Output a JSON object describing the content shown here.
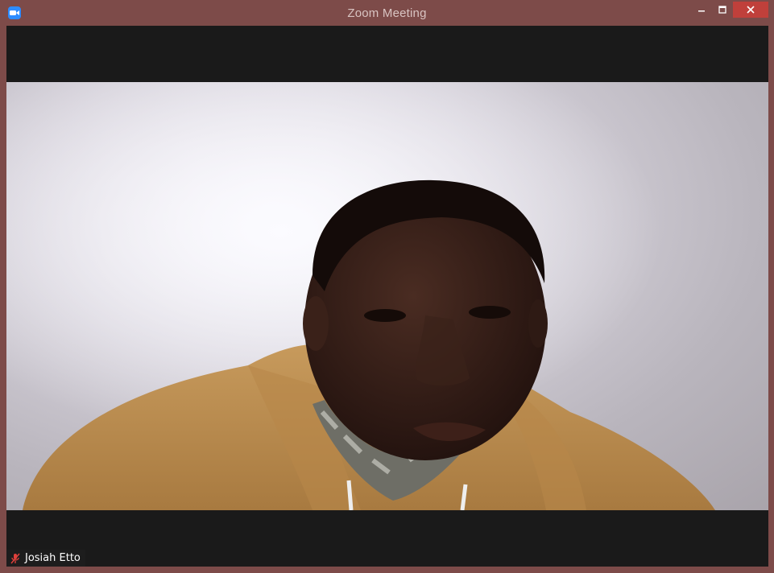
{
  "window": {
    "title": "Zoom Meeting",
    "accent": "#2d8cff",
    "titlebar_color": "#7d4b49",
    "close_color": "#c0403b"
  },
  "controls": {
    "minimize_icon": "minimize-icon",
    "maximize_icon": "maximize-icon",
    "close_icon": "close-icon"
  },
  "participant": {
    "name": "Josiah Etto",
    "mic_status_icon": "mic-muted-icon",
    "mic_muted": true
  }
}
